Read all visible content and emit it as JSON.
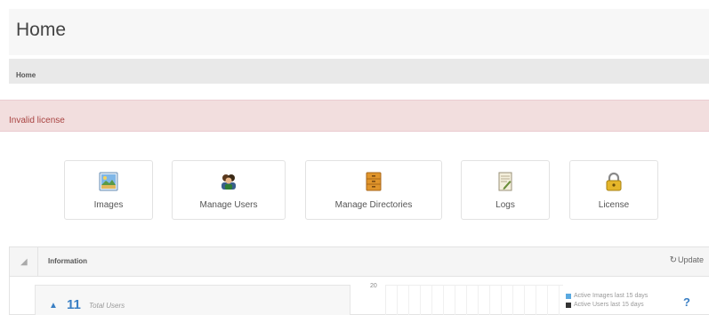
{
  "header": {
    "title": "Home"
  },
  "breadcrumb": {
    "current": "Home"
  },
  "alert": {
    "message": "Invalid license"
  },
  "shortcuts": [
    {
      "label": "Images",
      "icon": "image-icon"
    },
    {
      "label": "Manage Users",
      "icon": "users-icon"
    },
    {
      "label": "Manage Directories",
      "icon": "cabinet-icon"
    },
    {
      "label": "Logs",
      "icon": "log-document-icon"
    },
    {
      "label": "License",
      "icon": "lock-icon"
    }
  ],
  "info_panel": {
    "title": "Information",
    "update_label": "Update",
    "total_users": {
      "value": "11",
      "label": "Total Users"
    },
    "legend": [
      {
        "label": "Active Images last 15 days",
        "color": "#5aa9e0"
      },
      {
        "label": "Active Users last 15 days",
        "color": "#333333"
      }
    ],
    "help_icon": "?"
  },
  "chart_data": {
    "type": "bar",
    "y_ticks": [
      "20"
    ],
    "series": [
      {
        "name": "Active Images last 15 days",
        "values": []
      },
      {
        "name": "Active Users last 15 days",
        "values": []
      }
    ]
  },
  "colors": {
    "accent": "#3a7fc4",
    "alert_bg": "#f2dede",
    "alert_text": "#a94442"
  }
}
